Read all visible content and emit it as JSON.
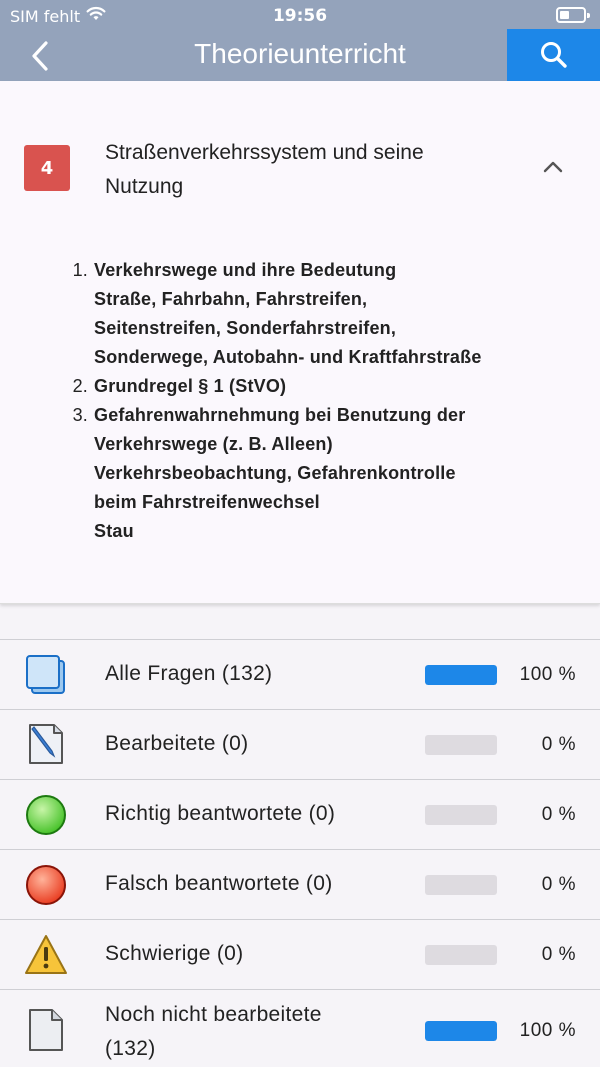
{
  "status": {
    "carrier": "SIM fehlt",
    "time": "19:56"
  },
  "nav": {
    "title": "Theorieunterricht"
  },
  "chapter": {
    "number": "4",
    "title_line1": "Straßenverkehrssystem und seine",
    "title_line2": "Nutzung",
    "topics": [
      {
        "num": "1.",
        "lines": [
          "Verkehrswege und ihre Bedeutung",
          "Straße, Fahrbahn, Fahrstreifen,",
          "Seitenstreifen, Sonderfahrstreifen,",
          "Sonderwege, Autobahn- und Kraftfahrstraße"
        ]
      },
      {
        "num": "2.",
        "lines": [
          "Grundregel § 1 (StVO)"
        ]
      },
      {
        "num": "3.",
        "lines": [
          "Gefahrenwahrnehmung bei Benutzung der",
          "Verkehrswege (z. B. Alleen)",
          "Verkehrsbeobachtung, Gefahrenkontrolle",
          "beim Fahrstreifenwechsel",
          "Stau"
        ]
      }
    ]
  },
  "categories": [
    {
      "label": "Alle Fragen (132)",
      "percent_text": "100 %",
      "progress": 1.0,
      "icon": "stack-icon"
    },
    {
      "label": "Bearbeitete (0)",
      "percent_text": "0 %",
      "progress": 0.0,
      "icon": "edit-document-icon"
    },
    {
      "label": "Richtig beantwortete (0)",
      "percent_text": "0 %",
      "progress": 0.0,
      "icon": "green-circle-icon"
    },
    {
      "label": "Falsch beantwortete (0)",
      "percent_text": "0 %",
      "progress": 0.0,
      "icon": "red-circle-icon"
    },
    {
      "label": "Schwierige (0)",
      "percent_text": "0 %",
      "progress": 0.0,
      "icon": "warning-icon"
    },
    {
      "label_line1": "Noch nicht bearbeitete",
      "label_line2": "(132)",
      "percent_text": "100 %",
      "progress": 1.0,
      "icon": "blank-document-icon"
    }
  ],
  "colors": {
    "header": "#94a3bb",
    "accent": "#1d87e8",
    "badge": "#d9534f"
  }
}
